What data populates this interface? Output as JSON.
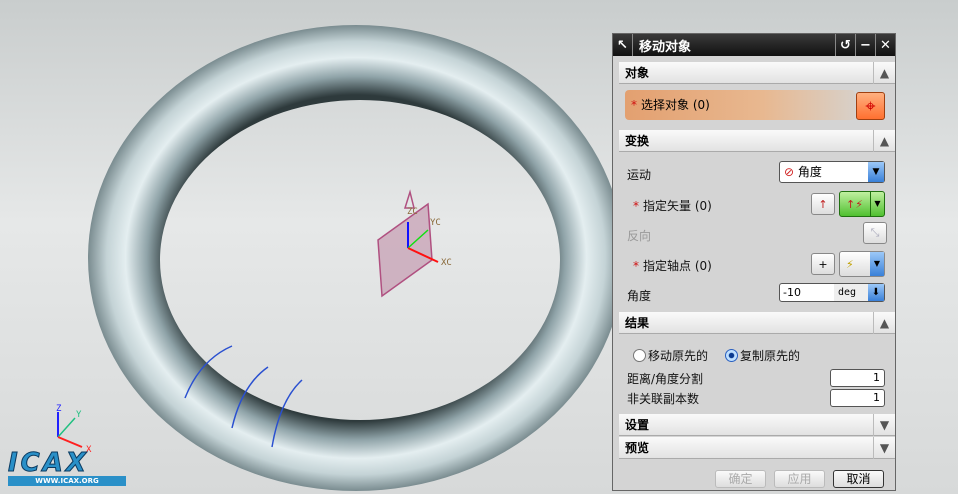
{
  "viewport": {
    "csys_labels": {
      "zc": "ZC",
      "yc": "YC",
      "xc": "XC"
    },
    "triad_labels": {
      "z": "Z",
      "y": "Y",
      "x": "X"
    },
    "logo": {
      "text": "ICAX",
      "url": "WWW.ICAX.ORG"
    }
  },
  "dialog": {
    "title": "移动对象",
    "sections": {
      "object": {
        "label": "对象",
        "select_label": "选择对象",
        "select_count": "(0)"
      },
      "transform": {
        "label": "变换",
        "motion_label": "运动",
        "motion_value": "角度",
        "vector_label": "指定矢量",
        "vector_count": "(0)",
        "reverse_label": "反向",
        "pivot_label": "指定轴点",
        "pivot_count": "(0)",
        "angle_label": "角度",
        "angle_value": "-10",
        "angle_unit": "deg"
      },
      "result": {
        "label": "结果",
        "radio_move": "移动原先的",
        "radio_copy": "复制原先的",
        "selected": "copy",
        "divisions_label": "距离/角度分割",
        "divisions_value": "1",
        "copies_label": "非关联副本数",
        "copies_value": "1"
      },
      "settings": {
        "label": "设置"
      },
      "preview": {
        "label": "预览"
      }
    },
    "buttons": {
      "ok": "确定",
      "apply": "应用",
      "cancel": "取消"
    }
  }
}
